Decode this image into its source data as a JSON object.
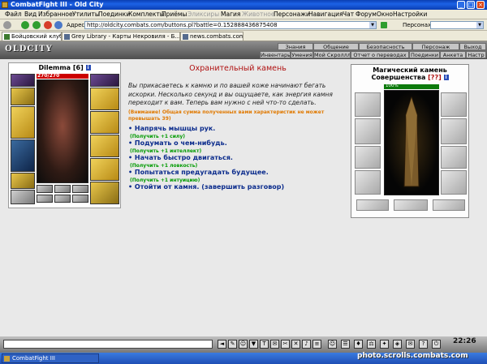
{
  "window": {
    "title": "CombatFight III - Old City"
  },
  "menu": {
    "items": [
      "Файл",
      "Вид",
      "Избранное",
      "Утилиты",
      "Поединки",
      "Комплекты",
      "Приёмы",
      "Эликсиры",
      "Магия",
      "Животное",
      "Персонажи",
      "Навигация",
      "Чат",
      "Форум",
      "Окно",
      "Настройки"
    ]
  },
  "address": {
    "label": "Адрес",
    "url": "http://oldcity.combats.com/buttons.pl?battle=0.152888436875408",
    "persona_label": "Персонаж:"
  },
  "tabs": [
    {
      "label": "Бойцовский клуб"
    },
    {
      "label": "Grey Library - Карты Некровиля - Б..."
    },
    {
      "label": "news.combats.com"
    }
  ],
  "game_nav": {
    "logo": "OLDCITY",
    "top": [
      "Знания",
      "Общение",
      "Безопасность",
      "Персонаж",
      "Выход"
    ],
    "bottom": [
      "Инвентарь",
      "Умения",
      "Мой Скроллл",
      "Отчет о переводах",
      "Поединки",
      "Анкета",
      "Настр"
    ]
  },
  "character": {
    "name": "Dilemma",
    "level": "[6]",
    "hp": "270/270",
    "hp_fraction": 1.0
  },
  "dialog": {
    "title": "Охранительный камень",
    "description": "Вы прикасаетесь к камню и по вашей коже начинают бегать искорки. Несколько секунд и вы ощущаете, как энергия камня переходит к вам. Теперь вам нужно с ней что-то сделать.",
    "warning": "(Внимание! Общая сумма полученных вами характеристик не может превышать 39)",
    "choices": [
      {
        "text": "• Напрячь мышцы рук.",
        "bonus": "(Получить +1 силу)"
      },
      {
        "text": "• Подумать о чем-нибудь.",
        "bonus": "(Получить +1 интеллект)"
      },
      {
        "text": "• Начать быстро двигаться.",
        "bonus": "(Получить +1 ловкость)"
      },
      {
        "text": "• Попытаться предугадать будущее.",
        "bonus": "(Получить +1 интуицию)"
      },
      {
        "text": "• Отойти от камня. (завершить разговор)",
        "bonus": ""
      }
    ]
  },
  "stone": {
    "title": "Магический камень",
    "name": "Совершенства",
    "level": "[??]",
    "hp": "100%",
    "hp_fraction": 1.0
  },
  "chat": {
    "clock": "22:26"
  },
  "status": {
    "task": "CombatFight III"
  },
  "watermark": "photo.scrolls.combats.com",
  "colors": {
    "accent_red": "#b01010",
    "link_blue": "#0a2b8c",
    "bonus_green": "#009a00",
    "warn_orange": "#e07900"
  }
}
